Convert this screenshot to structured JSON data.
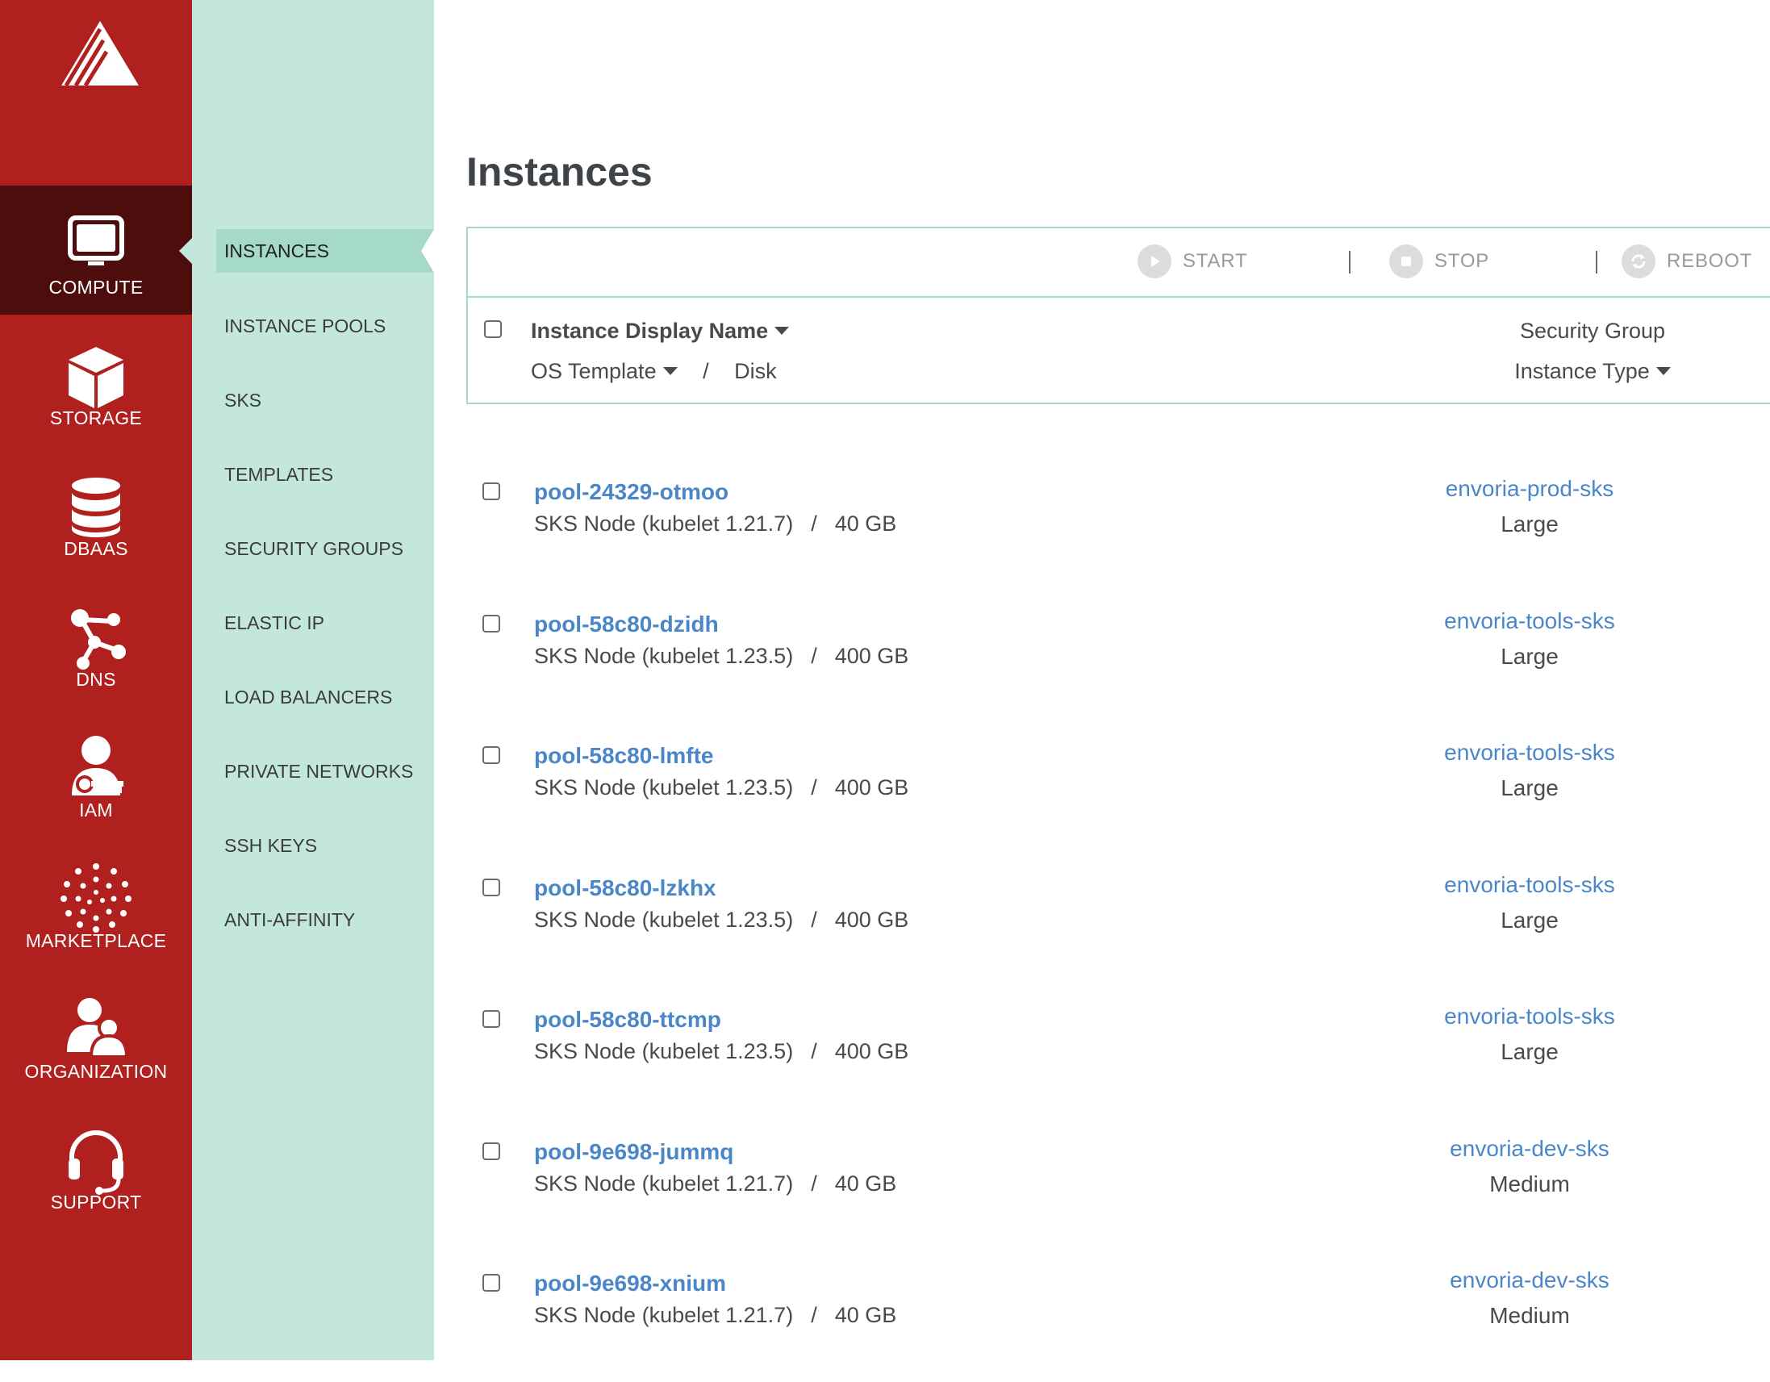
{
  "rail": {
    "items": [
      {
        "label": "COMPUTE",
        "icon": "monitor-icon"
      },
      {
        "label": "STORAGE",
        "icon": "cube-icon"
      },
      {
        "label": "DBAAS",
        "icon": "database-icon"
      },
      {
        "label": "DNS",
        "icon": "network-icon"
      },
      {
        "label": "IAM",
        "icon": "user-key-icon"
      },
      {
        "label": "MARKETPLACE",
        "icon": "dots-circle-icon"
      },
      {
        "label": "ORGANIZATION",
        "icon": "users-icon"
      },
      {
        "label": "SUPPORT",
        "icon": "headset-icon"
      }
    ]
  },
  "subnav": {
    "items": [
      {
        "label": "INSTANCES"
      },
      {
        "label": "INSTANCE POOLS"
      },
      {
        "label": "SKS"
      },
      {
        "label": "TEMPLATES"
      },
      {
        "label": "SECURITY GROUPS"
      },
      {
        "label": "ELASTIC IP"
      },
      {
        "label": "LOAD BALANCERS"
      },
      {
        "label": "PRIVATE NETWORKS"
      },
      {
        "label": "SSH KEYS"
      },
      {
        "label": "ANTI-AFFINITY"
      }
    ]
  },
  "page": {
    "title": "Instances"
  },
  "toolbar": {
    "start": "START",
    "stop": "STOP",
    "reboot": "REBOOT"
  },
  "table": {
    "headers": {
      "name": "Instance Display Name",
      "os_template": "OS Template",
      "slash": "/",
      "disk": "Disk",
      "security_group": "Security Group",
      "instance_type": "Instance Type"
    },
    "rows": [
      {
        "name": "pool-24329-otmoo",
        "template": "SKS Node (kubelet 1.21.7)",
        "sep": "/",
        "disk": "40 GB",
        "security_group": "envoria-prod-sks",
        "type": "Large"
      },
      {
        "name": "pool-58c80-dzidh",
        "template": "SKS Node (kubelet 1.23.5)",
        "sep": "/",
        "disk": "400 GB",
        "security_group": "envoria-tools-sks",
        "type": "Large"
      },
      {
        "name": "pool-58c80-lmfte",
        "template": "SKS Node (kubelet 1.23.5)",
        "sep": "/",
        "disk": "400 GB",
        "security_group": "envoria-tools-sks",
        "type": "Large"
      },
      {
        "name": "pool-58c80-lzkhx",
        "template": "SKS Node (kubelet 1.23.5)",
        "sep": "/",
        "disk": "400 GB",
        "security_group": "envoria-tools-sks",
        "type": "Large"
      },
      {
        "name": "pool-58c80-ttcmp",
        "template": "SKS Node (kubelet 1.23.5)",
        "sep": "/",
        "disk": "400 GB",
        "security_group": "envoria-tools-sks",
        "type": "Large"
      },
      {
        "name": "pool-9e698-jummq",
        "template": "SKS Node (kubelet 1.21.7)",
        "sep": "/",
        "disk": "40 GB",
        "security_group": "envoria-dev-sks",
        "type": "Medium"
      },
      {
        "name": "pool-9e698-xnium",
        "template": "SKS Node (kubelet 1.21.7)",
        "sep": "/",
        "disk": "40 GB",
        "security_group": "envoria-dev-sks",
        "type": "Medium"
      }
    ]
  },
  "colors": {
    "rail_bg": "#b0201f",
    "rail_active": "#4d0d0d",
    "subnav_bg": "#c3e7dc",
    "subnav_active": "#a5d9c8",
    "link": "#4a86c8",
    "panel_border": "#a8d8c6"
  }
}
